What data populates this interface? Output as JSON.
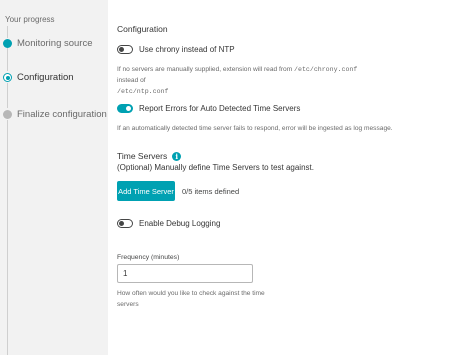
{
  "sidebar": {
    "title": "Your progress",
    "steps": [
      {
        "label": "Monitoring source",
        "state": "done"
      },
      {
        "label": "Configuration",
        "state": "current"
      },
      {
        "label": "Finalize configuration",
        "state": "pending"
      }
    ]
  },
  "config": {
    "title": "Configuration",
    "chrony": {
      "label": "Use chrony instead of NTP",
      "enabled": false,
      "help_prefix": "If no servers are manually supplied, extension will read from",
      "help_path1": "/etc/chrony.conf",
      "help_middle": "instead of",
      "help_path2": "/etc/ntp.conf"
    },
    "report_errors": {
      "label": "Report Errors for Auto Detected Time Servers",
      "enabled": true,
      "help": "If an automatically detected time server fails to respond, error will be ingested as log message."
    },
    "time_servers": {
      "title": "Time Servers",
      "info_icon": "info-icon",
      "description": "(Optional) Manually define Time Servers to test against.",
      "add_button": "Add Time Server",
      "count_text": "0/5 items defined"
    },
    "debug": {
      "label": "Enable Debug Logging",
      "enabled": false
    },
    "frequency": {
      "label": "Frequency (minutes)",
      "value": "1",
      "help_line1": "How often would you like to check against the time",
      "help_line2": "servers"
    }
  },
  "colors": {
    "accent": "#00a1b2",
    "sidebar_bg": "#f2f2f2",
    "text": "#353535",
    "muted": "#6a6a6a"
  }
}
